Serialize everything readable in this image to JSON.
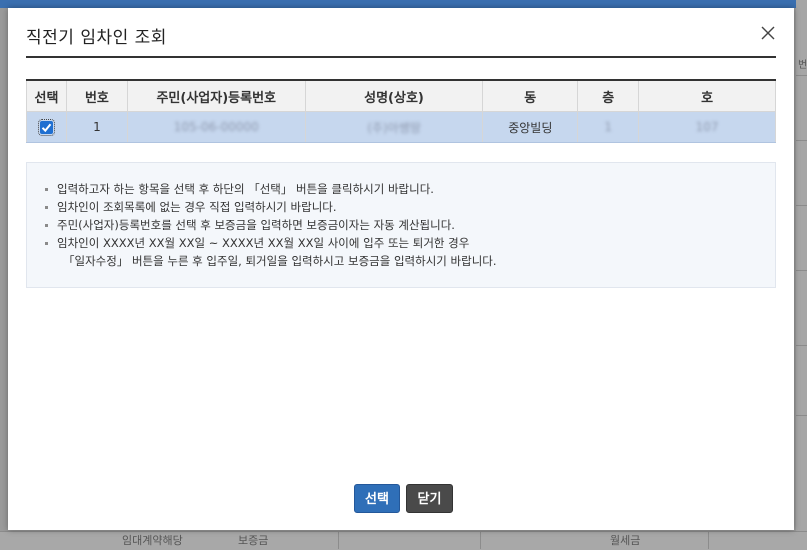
{
  "background": {
    "right_fragment": "번",
    "bottom_cells": [
      "임대계약해당",
      "보증금",
      "월세금"
    ]
  },
  "dialog": {
    "title": "직전기 임차인 조회",
    "close_icon": "close-icon"
  },
  "table": {
    "headers": [
      "선택",
      "번호",
      "주민(사업자)등록번호",
      "성명(상호)",
      "동",
      "층",
      "호"
    ],
    "rows": [
      {
        "selected": true,
        "no": "1",
        "reg_no": "105-06-00000",
        "name": "(주)아쌩땅",
        "dong": "중앙빌딩",
        "floor": "1",
        "ho": "107"
      }
    ]
  },
  "notice": {
    "items": [
      "입력하고자 하는 항목을 선택 후 하단의 「선택」 버튼을 클릭하시기 바랍니다.",
      "임차인이 조회목록에 없는 경우 직접 입력하시기 바랍니다.",
      "주민(사업자)등록번호를 선택 후 보증금을 입력하면 보증금이자는 자동 계산됩니다.",
      "임차인이 XXXX년 XX월 XX일 ~ XXXX년 XX월 XX일 사이에 입주 또는 퇴거한 경우"
    ],
    "continuation": "「일자수정」 버튼을 누른 후 입주일, 퇴거일을 입력하시고 보증금을 입력하시기 바랍니다."
  },
  "buttons": {
    "select_label": "선택",
    "close_label": "닫기"
  },
  "colors": {
    "primary": "#2f6fb8",
    "selected_row": "#c6d7ee",
    "checkbox": "#1f6fd1"
  }
}
